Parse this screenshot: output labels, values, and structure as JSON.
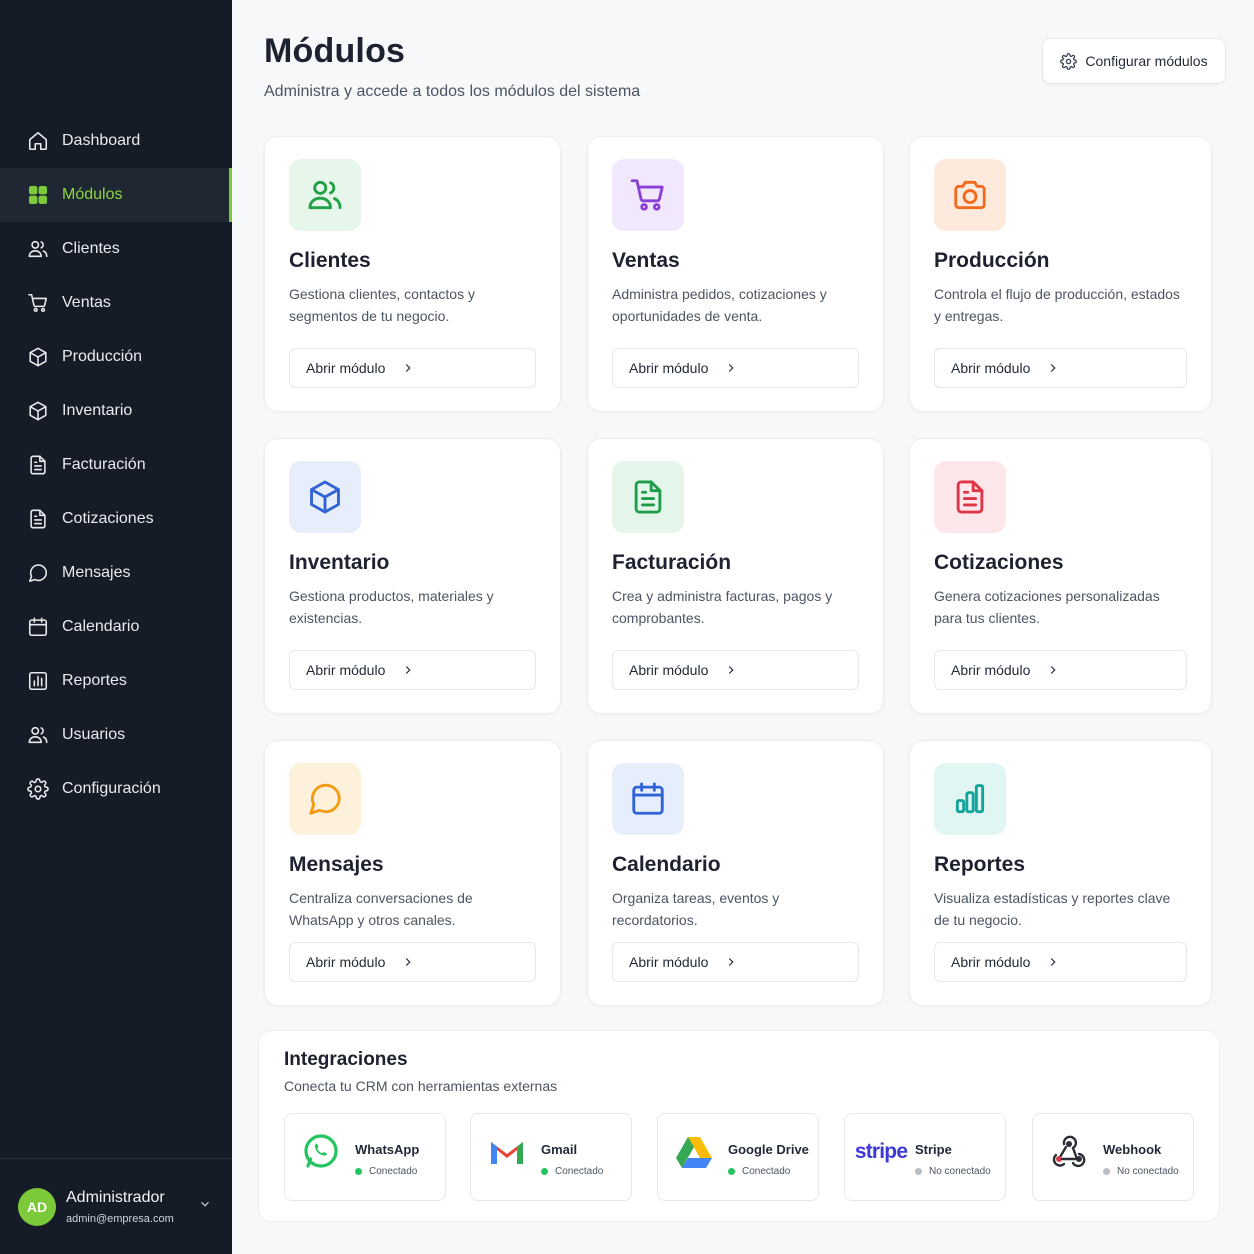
{
  "sidebar": {
    "items": [
      {
        "label": "Dashboard",
        "icon": "home-icon"
      },
      {
        "label": "Módulos",
        "icon": "grid-icon"
      },
      {
        "label": "Clientes",
        "icon": "users-icon"
      },
      {
        "label": "Ventas",
        "icon": "cart-icon"
      },
      {
        "label": "Producción",
        "icon": "box-icon"
      },
      {
        "label": "Inventario",
        "icon": "box-icon"
      },
      {
        "label": "Facturación",
        "icon": "document-icon"
      },
      {
        "label": "Cotizaciones",
        "icon": "document-icon"
      },
      {
        "label": "Mensajes",
        "icon": "chat-icon"
      },
      {
        "label": "Calendario",
        "icon": "calendar-icon"
      },
      {
        "label": "Reportes",
        "icon": "chart-icon"
      },
      {
        "label": "Usuarios",
        "icon": "users-icon"
      },
      {
        "label": "Configuración",
        "icon": "gear-icon"
      }
    ],
    "active_index": 1,
    "user": {
      "initials": "AD",
      "name": "Administrador",
      "email": "admin@empresa.com"
    }
  },
  "header": {
    "title": "Módulos",
    "subtitle": "Administra y accede a todos los módulos del sistema",
    "config_button": "Configurar módulos"
  },
  "modules": [
    {
      "title": "Clientes",
      "desc": "Gestiona clientes, contactos y segmentos de tu negocio.",
      "button": "Abrir módulo",
      "icon": "users-icon",
      "color": "#22a046",
      "bg": "#e6f6ea"
    },
    {
      "title": "Ventas",
      "desc": "Administra pedidos, cotizaciones y oportunidades de venta.",
      "button": "Abrir módulo",
      "icon": "cart-icon",
      "color": "#8b3fd9",
      "bg": "#f1e8fd"
    },
    {
      "title": "Producción",
      "desc": "Controla el flujo de producción, estados y entregas.",
      "button": "Abrir módulo",
      "icon": "camera-icon",
      "color": "#f26a1b",
      "bg": "#fdeadd"
    },
    {
      "title": "Inventario",
      "desc": "Gestiona productos, materiales y existencias.",
      "button": "Abrir módulo",
      "icon": "box-icon",
      "color": "#2f63d6",
      "bg": "#e6edfb"
    },
    {
      "title": "Facturación",
      "desc": "Crea y administra facturas, pagos y comprobantes.",
      "button": "Abrir módulo",
      "icon": "document-icon",
      "color": "#1e9c4a",
      "bg": "#e4f6e9"
    },
    {
      "title": "Cotizaciones",
      "desc": "Genera cotizaciones personalizadas para tus clientes.",
      "button": "Abrir módulo",
      "icon": "document-icon",
      "color": "#e03546",
      "bg": "#fde7ea"
    },
    {
      "title": "Mensajes",
      "desc": "Centraliza conversaciones de WhatsApp y otros canales.",
      "button": "Abrir módulo",
      "icon": "chat-icon",
      "color": "#f39b12",
      "bg": "#fdf1dc"
    },
    {
      "title": "Calendario",
      "desc": "Organiza tareas, eventos y recordatorios.",
      "button": "Abrir módulo",
      "icon": "calendar-icon",
      "color": "#2f63d6",
      "bg": "#e6edfb"
    },
    {
      "title": "Reportes",
      "desc": "Visualiza estadísticas y reportes clave de tu negocio.",
      "button": "Abrir módulo",
      "icon": "chart-icon",
      "color": "#13a39a",
      "bg": "#e1f5f3"
    }
  ],
  "integrations": {
    "title": "Integraciones",
    "subtitle": "Conecta tu CRM con herramientas externas",
    "items": [
      {
        "name": "WhatsApp",
        "status": "Conectado",
        "connected": true,
        "logo": "whatsapp-logo"
      },
      {
        "name": "Gmail",
        "status": "Conectado",
        "connected": true,
        "logo": "gmail-logo"
      },
      {
        "name": "Google Drive",
        "status": "Conectado",
        "connected": true,
        "logo": "google-drive-logo"
      },
      {
        "name": "Stripe",
        "status": "No conectado",
        "connected": false,
        "logo": "stripe-logo",
        "logo_text": "stripe"
      },
      {
        "name": "Webhook",
        "status": "No conectado",
        "connected": false,
        "logo": "webhook-logo"
      }
    ],
    "status_colors": {
      "connected": "#22c55e",
      "disconnected": "#b8bcc4"
    }
  }
}
